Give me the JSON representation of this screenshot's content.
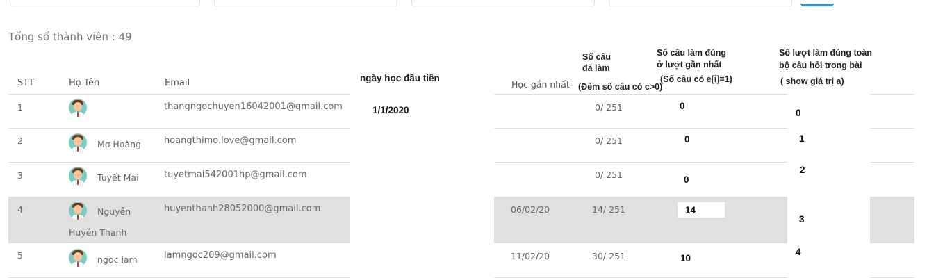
{
  "summary": {
    "total_label": "Tổng số thành viên : 49"
  },
  "headers": {
    "stt": "STT",
    "name": "Họ Tên",
    "email": "Email",
    "first_day": "ngày học đầu tiên",
    "last_study": "Học gần nhất",
    "done_1": "Số câu",
    "done_2": "đã làm",
    "done_3": "(Đếm số câu có c>0)",
    "correct_1": "Số câu làm đúng",
    "correct_2": "ở lượt gần nhất",
    "correct_3": "(Số câu có e[i]=1)",
    "full_1": "Số lượt làm đúng toàn",
    "full_2": "bộ câu hỏi trong bài",
    "full_3": "( show giá trị a)"
  },
  "rows": [
    {
      "stt": "1",
      "name_1": "",
      "name_2": "",
      "email": "thangngochuyen16042001@gmail.com",
      "first_day": "1/1/2020",
      "last": "",
      "done": "0/ 251",
      "correct": "0",
      "full": "0"
    },
    {
      "stt": "2",
      "name_1": "Mơ Hoàng",
      "name_2": "",
      "email": "hoangthimo.love@gmail.com",
      "first_day": "",
      "last": "",
      "done": "0/ 251",
      "correct": "0",
      "full": "1"
    },
    {
      "stt": "3",
      "name_1": "Tuyết Mai",
      "name_2": "",
      "email": "tuyetmai542001hp@gmail.com",
      "first_day": "",
      "last": "",
      "done": "0/ 251",
      "correct": "0",
      "full": "2"
    },
    {
      "stt": "4",
      "name_1": "Nguyễn",
      "name_2": "Huyền Thanh",
      "email": "huyenthanh28052000@gmail.com",
      "first_day": "",
      "last": "06/02/20",
      "done": "14/ 251",
      "correct": "14",
      "full": "3"
    },
    {
      "stt": "5",
      "name_1": "ngoc lam",
      "name_2": "",
      "email": "lamngoc209@gmail.com",
      "first_day": "",
      "last": "11/02/20",
      "done": "30/ 251",
      "correct": "10",
      "full": "4"
    }
  ]
}
